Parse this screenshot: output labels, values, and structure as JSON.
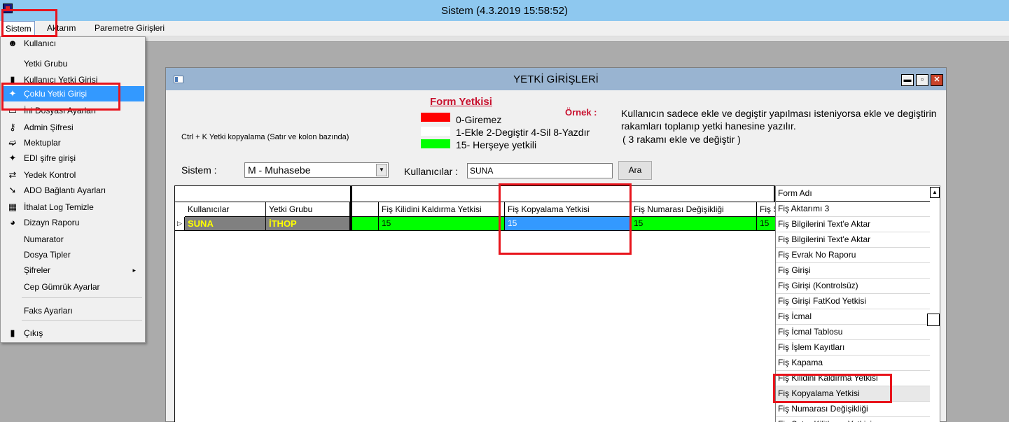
{
  "app": {
    "title": "Sistem (4.3.2019 15:58:52)"
  },
  "menubar": [
    {
      "name": "menu-sistem",
      "label": "Sistem"
    },
    {
      "name": "menu-aktarim",
      "label": "Aktarım"
    },
    {
      "name": "menu-paremetre",
      "label": "Paremetre Girişleri"
    }
  ],
  "dropdown": {
    "items": [
      {
        "name": "dd-kullanici",
        "label": "Kullanıcı",
        "icon": "☻",
        "iconName": "user-icon"
      },
      {
        "name": "dd-yetki-grubu",
        "label": "Yetki Grubu",
        "icon": "",
        "iconName": ""
      },
      {
        "name": "dd-kullanici-yetki-girisi",
        "label": "Kullanıcı Yetki Girişi",
        "icon": "▮",
        "iconName": "door-icon"
      },
      {
        "name": "dd-coklu-yetki-girisi",
        "label": "Çoklu Yetki Girişi",
        "icon": "✦",
        "iconName": "keys-icon",
        "highlighted": true
      },
      {
        "name": "dd-ini-dosyasi",
        "label": "İni Dosyası Ayarları",
        "icon": "▭",
        "iconName": "file-icon"
      },
      {
        "name": "dd-admin-sifresi",
        "label": "Admin Şifresi",
        "icon": "⚷",
        "iconName": "key-icon"
      },
      {
        "name": "dd-mektuplar",
        "label": "Mektuplar",
        "icon": "➫",
        "iconName": "letter-arrow-icon"
      },
      {
        "name": "dd-edi-sifre",
        "label": "EDI şifre girişi",
        "icon": "✦",
        "iconName": "keys-icon"
      },
      {
        "name": "dd-yedek-kontrol",
        "label": "Yedek Kontrol",
        "icon": "⇄",
        "iconName": "backup-icon"
      },
      {
        "name": "dd-ado-baglanti",
        "label": "ADO Bağlantı Ayarları",
        "icon": "➘",
        "iconName": "plug-icon"
      },
      {
        "name": "dd-ithalat-log",
        "label": "İthalat Log Temizle",
        "icon": "▦",
        "iconName": "log-icon"
      },
      {
        "name": "dd-dizayn-raporu",
        "label": "Dizayn Raporu",
        "icon": "◕",
        "iconName": "report-icon"
      },
      {
        "name": "dd-numarator",
        "label": "Numarator",
        "icon": "",
        "iconName": ""
      },
      {
        "name": "dd-dosya-tipler",
        "label": "Dosya Tipler",
        "icon": "",
        "iconName": ""
      },
      {
        "name": "dd-sifreler",
        "label": "Şifreler",
        "icon": "",
        "iconName": "",
        "submenu": "▸"
      },
      {
        "name": "dd-cep-gumruk",
        "label": "Cep Gümrük Ayarlar",
        "icon": "",
        "iconName": ""
      },
      {
        "name": "dd-faks-ayarlari",
        "label": "Faks Ayarları",
        "icon": "",
        "iconName": ""
      },
      {
        "name": "dd-cikis",
        "label": "Çıkış",
        "icon": "▮",
        "iconName": "exit-door-icon"
      }
    ]
  },
  "child": {
    "title": "YETKİ GİRİŞLERİ",
    "buttons": {
      "minimize": "▬",
      "maximize": "▫",
      "close": "✕"
    },
    "hint": "Ctrl + K Yetki kopyalama (Satır ve kolon bazında)",
    "form_yetkisi": {
      "title": "Form Yetkisi",
      "legend": [
        {
          "label": "0-Giremez",
          "color": "#ff0000"
        },
        {
          "label": "1-Ekle  2-Degiştir  4-Sil  8-Yazdır",
          "color": "#ffffff"
        },
        {
          "label": "15- Herşeye yetkili",
          "color": "#00ff00"
        }
      ]
    },
    "ornek": {
      "label": "Örnek :",
      "text": "Kullanıcın sadece ekle ve degiştir yapılması isteniyorsa  ekle ve degiştirin rakamları toplanıp yetki hanesine yazılır.",
      "note": "( 3 rakamı ekle ve değiştir )"
    },
    "sistem_label": "Sistem :",
    "sistem_value": "M - Muhasebe",
    "combo_arrow": "▼",
    "kullanicilar_label": "Kullanıcılar :",
    "kullanicilar_value": "SUNA",
    "ara_label": "Ara"
  },
  "grid": {
    "indicator": "▷",
    "columns": [
      "Kullanıcılar",
      "Yetki Grubu",
      "",
      "Fiş Kilidini Kaldırma Yetkisi",
      "Fiş Kopyalama Yetkisi",
      "Fiş Numarası Değişikliği",
      "Fiş S"
    ],
    "row": [
      "SUNA",
      "İTHOP",
      "",
      "15",
      "15",
      "15",
      "15"
    ]
  },
  "listbox": {
    "header": "Form Adı",
    "scroll_up": "▲",
    "items": [
      "Fiş Aktarımı 3",
      "Fiş Bilgilerini  Text'e Aktar",
      "Fiş Bilgilerini Text'e Aktar",
      "Fiş Evrak No Raporu",
      "Fiş Girişi",
      "Fiş Girişi (Kontrolsüz)",
      "Fiş Girişi FatKod Yetkisi",
      "Fiş İcmal",
      "Fiş İcmal Tablosu",
      "Fiş İşlem Kayıtları",
      "Fiş Kapama",
      "Fiş Kilidini Kaldırma Yetkisi",
      "Fiş Kopyalama Yetkisi",
      "Fiş Numarası Değişikliği",
      "Fiş Satırı Kilitleme Yetkisi"
    ],
    "selected_index": 12
  },
  "annotation_color": "#e8141c"
}
